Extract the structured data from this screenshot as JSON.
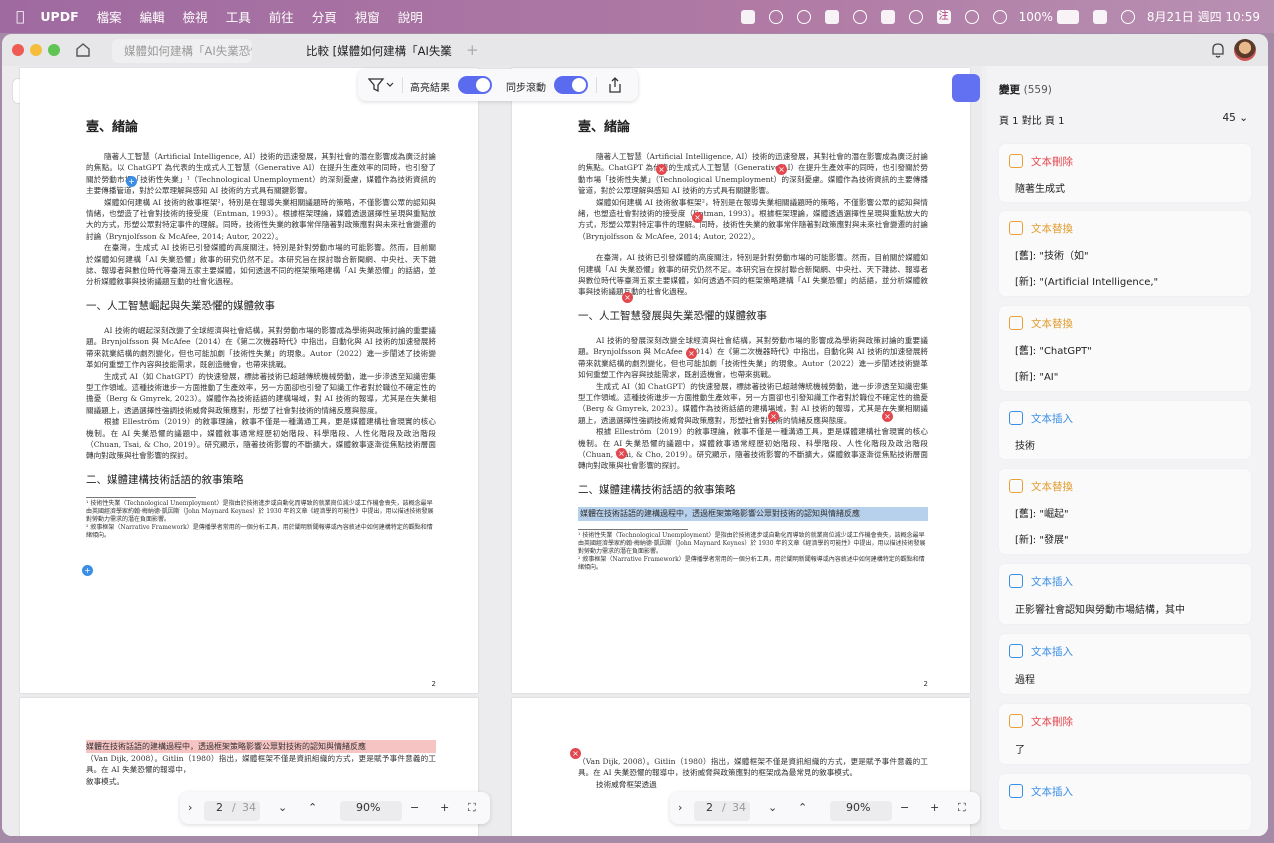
{
  "menubar": {
    "app": "UPDF",
    "items": [
      "檔案",
      "編輯",
      "檢視",
      "工具",
      "前往",
      "分頁",
      "視窗",
      "說明"
    ],
    "battery": "100%",
    "ime": "注",
    "clock": "8月21日 週四 10:59"
  },
  "window": {
    "tabs": [
      {
        "label": "媒體如何建構「AI失業恐懼」",
        "active": false
      },
      {
        "label": "比較 [媒體如何建構「AI失業",
        "active": true
      }
    ]
  },
  "toolbar": {
    "highlight_label": "高亮結果",
    "sync_label": "同步滾動",
    "highlight_on": true,
    "sync_on": true
  },
  "left_doc": {
    "heading": "壹、緒論",
    "p1": "隨著人工智慧（Artificial Intelligence, AI）技術的迅速發展，其對社會的潛在影響成為廣泛討論的焦點。以 ChatGPT 為代表的生成式人工智慧（Generative AI）在提升生產效率的同時，也引發了關於勞動市場「技術性失業」¹（Technological Unemployment）的深刻憂慮，媒體作為技術資訊的主要傳播管道，對於公眾理解與感知 AI 技術的方式具有關鍵影響。",
    "p2": "媒體如何建構 AI 技術的敘事框架²，特別是在報導失業相關議題時的策略，不僅影響公眾的認知與情緒，也塑造了社會對技術的接受度（Entman, 1993）。根據框架理論，媒體透過選擇性呈現與重點放大的方式，形塑公眾對特定事件的理解。同時，技術性失業的敘事常伴隨著對政策應對與未來社會變遷的討論（Brynjolfsson & McAfee, 2014; Autor, 2022）。",
    "p3": "在臺灣，生成式 AI 技術已引發媒體的高度關注，特別是針對勞動市場的可能影響。然而，目前關於媒體如何建構「AI 失業恐懼」敘事的研究仍然不足。本研究旨在探討聯合新聞網、中央社、天下雜誌、報導者與數位時代等臺灣五家主要媒體，如何透過不同的框架策略建構「AI 失業恐懼」的話語，並分析媒體敘事與技術議題互動的社會化過程。",
    "h2a": "一、人工智慧崛起與失業恐懼的媒體敘事",
    "p4": "AI 技術的崛起深刻改變了全球經濟與社會結構，其對勞動市場的影響成為學術與政策討論的重要議題。Brynjolfsson 與 McAfee（2014）在《第二次機器時代》中指出，自動化與 AI 技術的加速發展將帶來就業結構的劇烈變化，但也可能加劇「技術性失業」的現象。Autor（2022）進一步闡述了技術變革如何重塑工作內容與技能需求，既創造機會，也帶來挑戰。",
    "p5": "生成式 AI（如 ChatGPT）的快速發展，標誌著技術已超越傳統機械勞動，進一步滲透至知識密集型工作領域。這種技術進步一方面推動了生產效率，另一方面卻也引發了知識工作者對於職位不確定性的擔憂（Berg & Gmyrek, 2023）。媒體作為技術話語的建構場域，對 AI 技術的報導，尤其是在失業相關議題上，透過選擇性強調技術威脅與政策應對，形塑了社會對技術的情緒反應與態度。",
    "p6": "根據 Elleström（2019）的敘事理論，敘事不僅是一種溝通工具，更是媒體建構社會現實的核心機制。在 AI 失業恐懼的議題中，媒體敘事通常經歷初始階段、科學階段、人性化階段及政治階段（Chuan, Tsai, & Cho, 2019）。研究顯示，隨著技術影響的不斷擴大，媒體敘事逐漸從焦點技術層面轉向對政策與社會影響的探討。",
    "h2b": "二、媒體建構技術話語的敘事策略",
    "fn1": "¹ 技術性失業（Technological Unemployment）是指由於技術進步或自動化而導致的就業崗位減少或工作機會喪失，該概念最早由英國經濟學家約翰·梅納德·凱因斯（John Maynard Keynes）於 1930 年的文章《經濟學的可能性》中提出，用以描述技術發展對勞動力需求的潛在負面影響。",
    "fn2": "² 敘事框架（Narrative Framework）是傳播學者常用的一個分析工具，用於闡明新聞報導或內容敘述中如何建構特定的觀點和情緒傾向。",
    "page_number": "2",
    "p2_hl": "媒體在技術話語的建構過程中，透過框架策略影響公眾對技術的認知與情緒反應",
    "p2_lines": [
      "（Van Dijk, 2008）。Gitlin（1980）指出，媒體框架不僅是資訊組織的方式，更是賦予事件意義的工具。在 AI 失業恐懼的報導中，",
      "敘事模式。"
    ]
  },
  "right_doc": {
    "heading": "壹、緒論",
    "p1": "隨著人工智慧（Artificial Intelligence, AI）技術的迅速發展，其對社會的潛在影響成為廣泛討論的焦點。ChatGPT 為代表的生成式人工智慧（Generative AI）在提升生產效率的同時，也引發關於勞動市場「技術性失業」（Technological Unemployment）的深刻憂慮。媒體作為技術資訊的主要傳播管道，對於公眾理解與感知 AI 技術的方式具有關鍵影響。",
    "p2": "媒體如何建構 AI 技術敘事框架²，特別是在報導失業相關議題時的策略，不僅影響公眾的認知與情緒，也塑造社會對技術的接受度（Entman, 1993）。根據框架理論，媒體透過選擇性呈現與重點放大的方式，形塑公眾對特定事件的理解。同時，技術性失業的敘事常伴隨著對政策應對與未來社會變遷的討論（Brynjolfsson & McAfee, 2014; Autor, 2022）。",
    "p3": "在臺灣，AI 技術已引發媒體的高度關注，特別是針對勞動市場的可能影響。然而，目前關於媒體如何建構「AI 失業恐懼」敘事的研究仍然不足。本研究旨在探討聯合新聞網、中央社、天下雜誌、報導者與數位時代等臺灣五家主要媒體，如何透過不同的框架策略建構「AI 失業恐懼」的話語，並分析媒體敘事與技術議題互動的社會化過程。",
    "h2a": "一、人工智慧發展與失業恐懼的媒體敘事",
    "p4": "AI 技術的發展深刻改變全球經濟與社會結構，其對勞動市場的影響成為學術與政策討論的重要議題。Brynjolfsson 與 McAfee（2014）在《第二次機器時代》中指出，自動化與 AI 技術的加速發展將帶來就業結構的劇烈變化，但也可能加劇「技術性失業」的現象。Autor（2022）進一步闡述技術變革如何重塑工作內容與技能需求，既創造機會，也帶來挑戰。",
    "p5": "生成式 AI（如 ChatGPT）的快速發展，標誌著技術已超越傳統機械勞動，進一步滲透至知識密集型工作領域。這種技術進步一方面推動生產效率，另一方面卻也引發知識工作者對於職位不確定性的擔憂（Berg & Gmyrek, 2023）。媒體作為技術話語的建構場域，對 AI 技術的報導，尤其是在失業相關議題上，透過選擇性強調技術威脅與政策應對，形塑社會對技術的情緒反應與態度。",
    "p6": "根據 Elleström（2019）的敘事理論，敘事不僅是一種溝通工具，更是媒體建構社會現實的核心機制。在 AI 失業恐懼的議題中，媒體敘事通常經歷初始階段、科學階段、人性化階段及政治階段（Chuan, Tsai, & Cho, 2019）。研究顯示，隨著技術影響的不斷擴大，媒體敘事逐漸從焦點技術層面轉向對政策與社會影響的探討。",
    "h2b": "二、媒體建構技術話語的敘事策略",
    "hl": "媒體在技術話語的建構過程中，透過框架策略影響公眾對技術的認知與情緒反應",
    "fn1": "¹ 技術性失業（Technological Unemployment）是指由於技術進步或自動化而導致的就業崗位減少或工作機會喪失，該概念最早由英國經濟學家約翰·梅納德·凱因斯（John Maynard Keynes）於 1930 年的文章《經濟學的可能性》中提出，用以描述技術發展對勞動力需求的潛在負面影響。",
    "fn2": "² 敘事框架（Narrative Framework）是傳播學者常用的一個分析工具，用於闡明新聞報導或內容敘述中如何建構特定的觀點和情緒傾向。",
    "page_number": "2",
    "p2_lines": [
      "（Van Dijk, 2008）。Gitlin（1980）指出，媒體框架不僅是資訊組織的方式，更是賦予事件意義的工具。在 AI 失業恐懼的報導中，技術威脅與政策應對的框架成為最常見的敘事模式。",
      "技術威脅框架透過"
    ]
  },
  "nav_left": {
    "page": "2",
    "total": "34",
    "zoom": "90%"
  },
  "nav_right": {
    "page": "2",
    "total": "34",
    "zoom": "90%"
  },
  "panel": {
    "title": "變更",
    "count": "(559)",
    "compare_label": "頁 1 對比 頁 1",
    "zoom_value": "45",
    "changes": [
      {
        "type": "文本刪除",
        "kind": "del",
        "lines": [
          "隨著生成式"
        ]
      },
      {
        "type": "文本替換",
        "kind": "rep",
        "lines": [
          "[舊]: \"技術（如\"",
          "[新]: \"(Artificial  Intelligence,\""
        ]
      },
      {
        "type": "文本替換",
        "kind": "rep",
        "lines": [
          "[舊]: \"ChatGPT\"",
          "[新]: \"AI\""
        ]
      },
      {
        "type": "文本插入",
        "kind": "ins",
        "lines": [
          "技術"
        ]
      },
      {
        "type": "文本替換",
        "kind": "rep",
        "lines": [
          "[舊]: \"崛起\"",
          "[新]: \"發展\""
        ]
      },
      {
        "type": "文本插入",
        "kind": "ins",
        "lines": [
          "正影響社會認知與勞動市場結構，其中"
        ]
      },
      {
        "type": "文本插入",
        "kind": "ins",
        "lines": [
          "過程"
        ]
      },
      {
        "type": "文本刪除",
        "kind": "del",
        "lines": [
          "了"
        ]
      },
      {
        "type": "文本插入",
        "kind": "ins",
        "lines": []
      }
    ]
  },
  "colors": {
    "accent": "#5a6bf0",
    "insert": "#3a8ee6",
    "replace": "#e29c2e",
    "delete": "#e4484f",
    "highlight": "#b7d0ec"
  }
}
